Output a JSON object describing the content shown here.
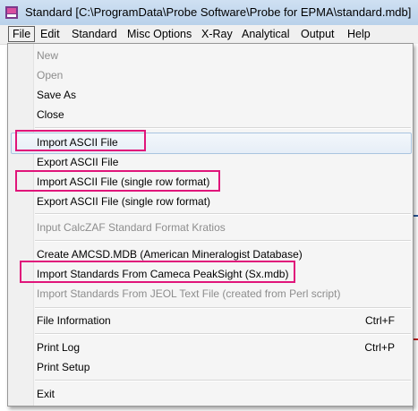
{
  "window": {
    "title": "Standard [C:\\ProgramData\\Probe Software\\Probe for EPMA\\standard.mdb]"
  },
  "menubar": [
    "File",
    "Edit",
    "Standard",
    "Misc Options",
    "X-Ray",
    "Analytical",
    "Output",
    "Help"
  ],
  "file_menu": {
    "new": "New",
    "open": "Open",
    "save_as": "Save As",
    "close": "Close",
    "import_ascii": "Import ASCII File",
    "export_ascii": "Export ASCII File",
    "import_ascii_single": "Import ASCII File (single row format)",
    "export_ascii_single": "Export ASCII File (single row format)",
    "input_calczaf": "Input CalcZAF Standard Format Kratios",
    "create_amcsd": "Create AMCSD.MDB (American Mineralogist Database)",
    "import_cameca": "Import Standards From Cameca PeakSight (Sx.mdb)",
    "import_jeol": "Import Standards From JEOL Text File (created from Perl script)",
    "file_information": "File Information",
    "file_information_accel": "Ctrl+F",
    "print_log": "Print Log",
    "print_log_accel": "Ctrl+P",
    "print_setup": "Print Setup",
    "exit": "Exit"
  },
  "colors": {
    "highlight_box": "#e0157a",
    "hover_fill": "#e6eef7",
    "disabled_text": "#8d8d8d"
  }
}
